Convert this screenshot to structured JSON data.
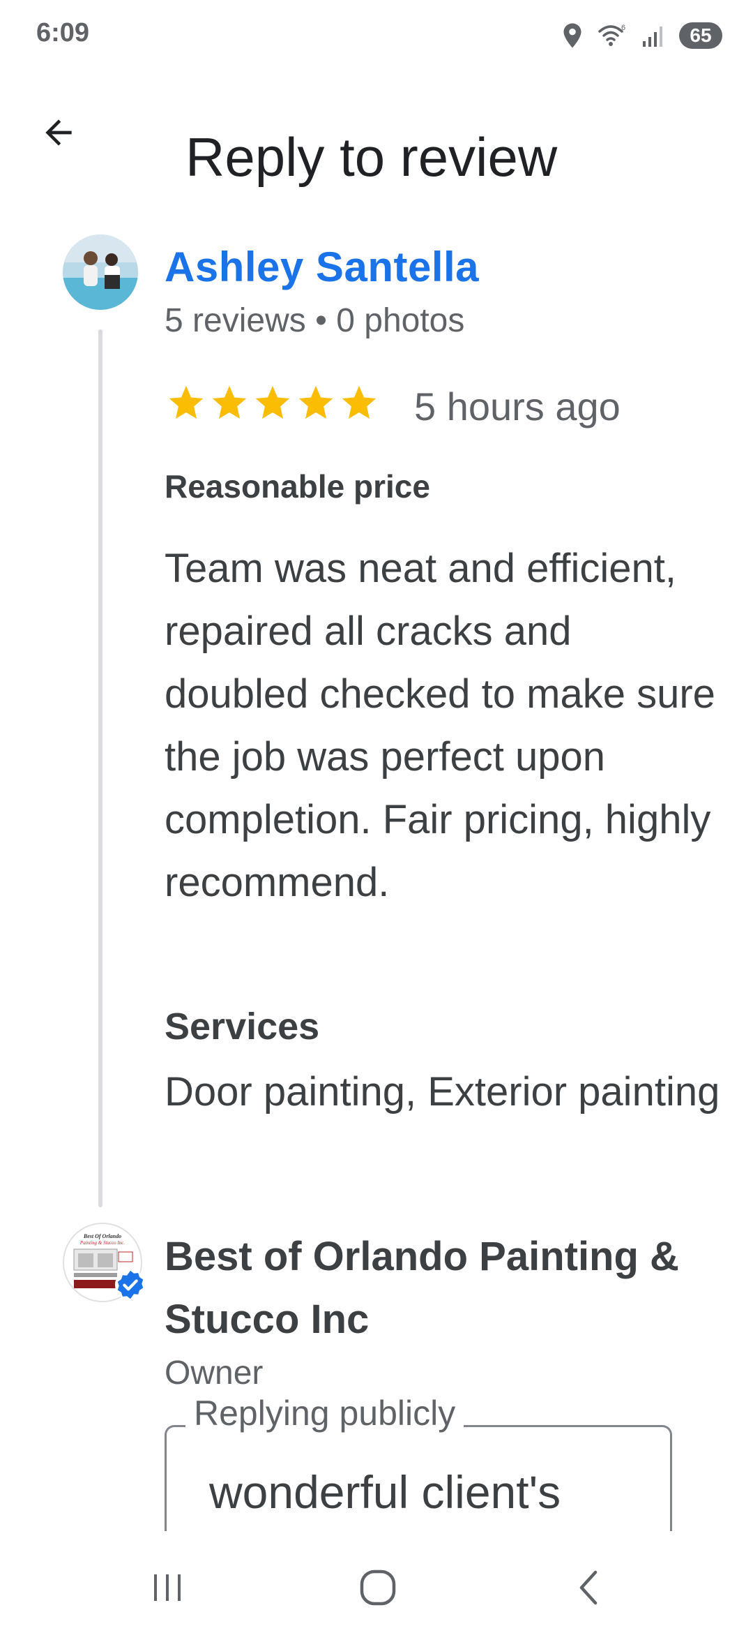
{
  "status_bar": {
    "time": "6:09",
    "battery": "65",
    "icons": [
      "location-icon",
      "wifi-icon",
      "signal-icon",
      "battery-icon"
    ]
  },
  "header": {
    "title": "Reply to review",
    "back_icon": "arrow-back-icon"
  },
  "review": {
    "reviewer_name": "Ashley Santella",
    "reviewer_meta": "5 reviews • 0 photos",
    "rating": 5,
    "rating_max": 5,
    "time_ago": "5 hours ago",
    "highlight": "Reasonable price",
    "body": "Team was neat and efficient, repaired all cracks and doubled checked to make sure the job was perfect upon completion. Fair pricing, highly recommend.",
    "services_label": "Services",
    "services_value": "Door painting, Exterior painting"
  },
  "owner": {
    "name": "Best of Orlando Painting & Stucco Inc",
    "role": "Owner",
    "logo_text": [
      "Best Of Orlando",
      "Painting & Stucco Inc."
    ]
  },
  "reply": {
    "label": "Replying publicly",
    "value": "wonderful client's"
  },
  "nav_bar": {
    "icons": [
      "recent-apps-icon",
      "home-icon",
      "back-icon"
    ]
  },
  "colors": {
    "accent": "#1a73e8",
    "star": "#fbbc04",
    "text": "#3c4043",
    "secondary_text": "#5f6368"
  }
}
